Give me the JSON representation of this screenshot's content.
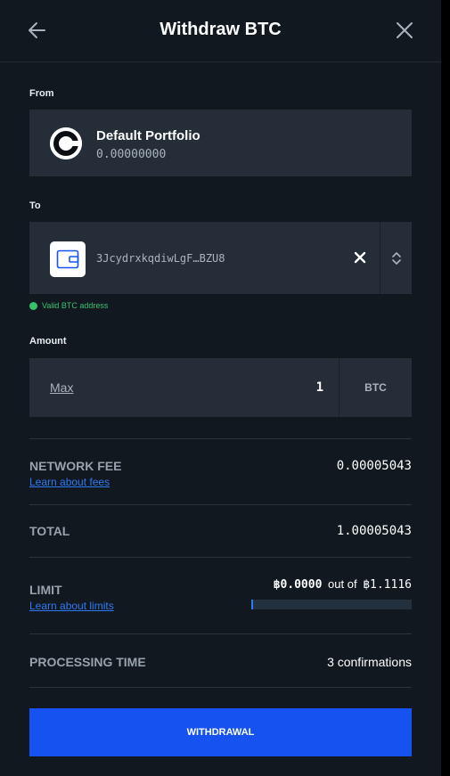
{
  "header": {
    "title": "Withdraw BTC"
  },
  "from": {
    "label": "From",
    "portfolio_name": "Default Portfolio",
    "balance": "0.00000000"
  },
  "to": {
    "label": "To",
    "address": "3JcydrxkqdiwLgF…BZU8",
    "validation": "Valid BTC address"
  },
  "amount": {
    "label": "Amount",
    "max_label": "Max",
    "value": "1",
    "currency": "BTC"
  },
  "network_fee": {
    "label": "NETWORK FEE",
    "link": "Learn about fees",
    "value": "0.00005043"
  },
  "total": {
    "label": "TOTAL",
    "value": "1.00005043"
  },
  "limit": {
    "label": "LIMIT",
    "link": "Learn about limits",
    "used": "฿0.0000",
    "separator": "out of",
    "max": "฿1.1116",
    "fraction_used": 0.0
  },
  "processing": {
    "label": "PROCESSING TIME",
    "value": "3 confirmations"
  },
  "actions": {
    "withdraw_label": "WITHDRAWAL"
  },
  "colors": {
    "background": "#111820",
    "card": "#242d38",
    "accent": "#1652f0",
    "link": "#2d7bf4",
    "success": "#36c26b"
  },
  "icons": {
    "back": "arrow-left-icon",
    "close": "close-icon",
    "logo": "coinbase-logo-icon",
    "wallet": "wallet-icon",
    "clear": "clear-icon",
    "picker": "chevron-up-down-icon"
  }
}
